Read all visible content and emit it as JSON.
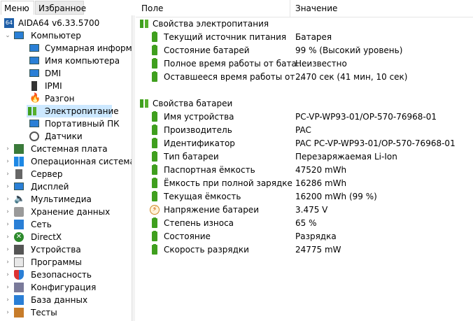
{
  "tabs": {
    "menu": "Меню",
    "favorites": "Избранное"
  },
  "tree": {
    "root": "AIDA64 v6.33.5700",
    "computer": "Компьютер",
    "computer_children": [
      "Суммарная информация",
      "Имя компьютера",
      "DMI",
      "IPMI",
      "Разгон",
      "Электропитание",
      "Портативный ПК",
      "Датчики"
    ],
    "sections": [
      "Системная плата",
      "Операционная система",
      "Сервер",
      "Дисплей",
      "Мультимедиа",
      "Хранение данных",
      "Сеть",
      "DirectX",
      "Устройства",
      "Программы",
      "Безопасность",
      "Конфигурация",
      "База данных",
      "Тесты"
    ]
  },
  "columns": {
    "field": "Поле",
    "value": "Значение"
  },
  "groups": [
    {
      "title": "Свойства электропитания",
      "rows": [
        {
          "field": "Текущий источник питания",
          "value": "Батарея"
        },
        {
          "field": "Состояние батарей",
          "value": "99 % (Высокий уровень)"
        },
        {
          "field": "Полное время работы от бата...",
          "value": "Неизвестно"
        },
        {
          "field": "Оставшееся время работы от ...",
          "value": "2470 сек (41 мин, 10 сек)"
        }
      ]
    },
    {
      "title": "Свойства батареи",
      "rows": [
        {
          "field": "Имя устройства",
          "value": "PC-VP-WP93-01/OP-570-76968-01"
        },
        {
          "field": "Производитель",
          "value": "PAC"
        },
        {
          "field": "Идентификатор",
          "value": "PAC  PC-VP-WP93-01/OP-570-76968-01"
        },
        {
          "field": "Тип батареи",
          "value": "Перезаряжаемая Li-Ion"
        },
        {
          "field": "Паспортная ёмкость",
          "value": "47520 mWh"
        },
        {
          "field": "Ёмкость при полной зарядке",
          "value": "16286 mWh"
        },
        {
          "field": "Текущая ёмкость",
          "value": "16200 mWh  (99 %)"
        },
        {
          "field": "Напряжение батареи",
          "value": "3.475 V"
        },
        {
          "field": "Степень износа",
          "value": "65 %"
        },
        {
          "field": "Состояние",
          "value": "Разрядка"
        },
        {
          "field": "Скорость разрядки",
          "value": "24775 mW"
        }
      ]
    }
  ]
}
